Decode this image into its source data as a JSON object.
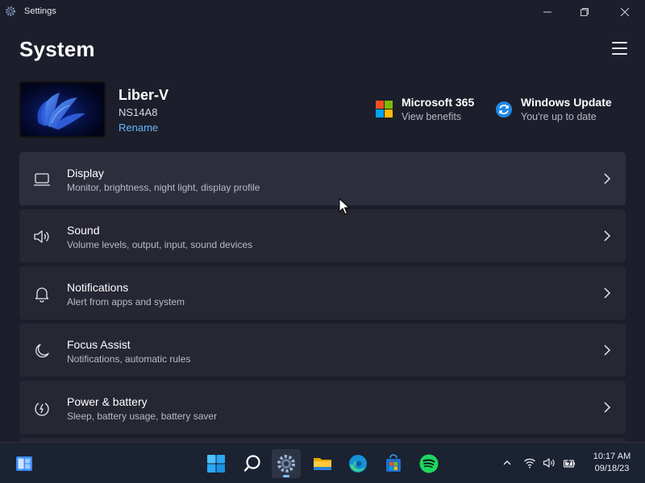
{
  "window": {
    "title": "Settings"
  },
  "page": {
    "title": "System"
  },
  "device": {
    "name": "Liber-V",
    "model": "NS14A8",
    "rename_label": "Rename"
  },
  "quick_links": [
    {
      "title": "Microsoft 365",
      "subtitle": "View benefits",
      "icon": "microsoft-logo-icon"
    },
    {
      "title": "Windows Update",
      "subtitle": "You're up to date",
      "icon": "windows-update-icon"
    }
  ],
  "settings": [
    {
      "title": "Display",
      "subtitle": "Monitor, brightness, night light, display profile",
      "icon": "display-icon"
    },
    {
      "title": "Sound",
      "subtitle": "Volume levels, output, input, sound devices",
      "icon": "speaker-icon"
    },
    {
      "title": "Notifications",
      "subtitle": "Alert from apps and system",
      "icon": "bell-icon"
    },
    {
      "title": "Focus Assist",
      "subtitle": "Notifications, automatic rules",
      "icon": "moon-icon"
    },
    {
      "title": "Power & battery",
      "subtitle": "Sleep, battery usage, battery saver",
      "icon": "power-icon"
    }
  ],
  "taskbar": {
    "time": "10:17 AM",
    "date": "09/18/23",
    "apps": [
      "widgets-icon",
      "start-icon",
      "search-icon",
      "settings-icon",
      "file-explorer-icon",
      "edge-icon",
      "store-icon",
      "spotify-icon"
    ],
    "tray": [
      "chevron-up-icon",
      "wifi-icon",
      "volume-icon",
      "battery-icon"
    ]
  },
  "colors": {
    "accent": "#60b8ff",
    "background": "#1d1e2b",
    "card": "#262733"
  }
}
